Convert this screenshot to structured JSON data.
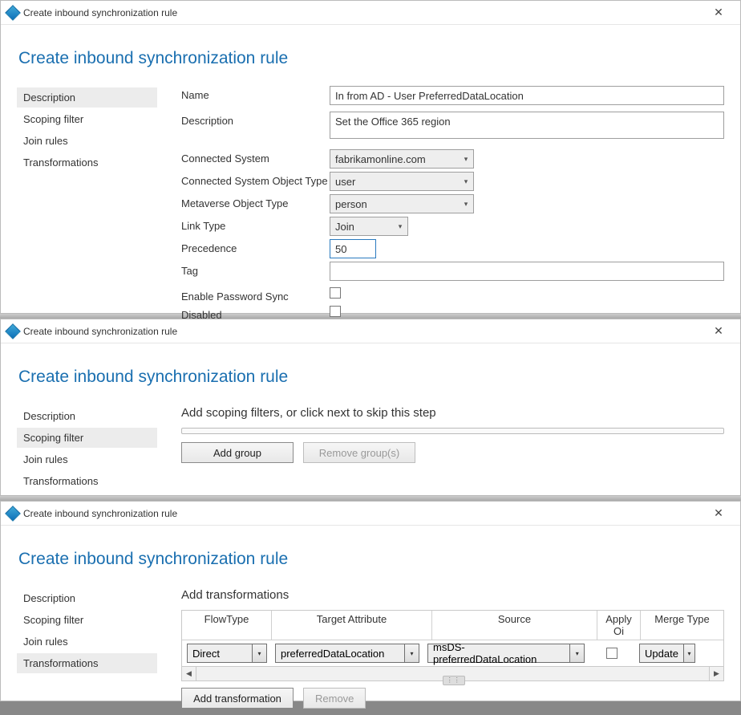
{
  "windows": [
    {
      "title": "Create inbound synchronization rule",
      "page_title": "Create inbound synchronization rule",
      "sidebar": {
        "items": [
          "Description",
          "Scoping filter",
          "Join rules",
          "Transformations"
        ],
        "active": 0
      },
      "form": {
        "name_label": "Name",
        "name_value": "In from AD - User PreferredDataLocation",
        "description_label": "Description",
        "description_value": "Set the Office 365 region",
        "cs_label": "Connected System",
        "cs_value": "fabrikamonline.com",
        "csot_label": "Connected System Object Type",
        "csot_value": "user",
        "mot_label": "Metaverse Object Type",
        "mot_value": "person",
        "lt_label": "Link Type",
        "lt_value": "Join",
        "prec_label": "Precedence",
        "prec_value": "50",
        "tag_label": "Tag",
        "tag_value": "",
        "eps_label": "Enable Password Sync",
        "disabled_label": "Disabled"
      }
    },
    {
      "title": "Create inbound synchronization rule",
      "page_title": "Create inbound synchronization rule",
      "sidebar": {
        "items": [
          "Description",
          "Scoping filter",
          "Join rules",
          "Transformations"
        ],
        "active": 1
      },
      "scoping": {
        "heading": "Add scoping filters, or click next to skip this step",
        "add_group": "Add group",
        "remove_group": "Remove group(s)"
      }
    },
    {
      "title": "Create inbound synchronization rule",
      "page_title": "Create inbound synchronization rule",
      "sidebar": {
        "items": [
          "Description",
          "Scoping filter",
          "Join rules",
          "Transformations"
        ],
        "active": 3
      },
      "transform": {
        "heading": "Add transformations",
        "columns": {
          "flowtype": "FlowType",
          "target": "Target Attribute",
          "source": "Source",
          "apply": "Apply Oi",
          "merge": "Merge Type"
        },
        "row": {
          "flowtype": "Direct",
          "target": "preferredDataLocation",
          "source": "msDS-preferredDataLocation",
          "merge": "Update"
        },
        "add_btn": "Add transformation",
        "remove_btn": "Remove"
      }
    }
  ]
}
